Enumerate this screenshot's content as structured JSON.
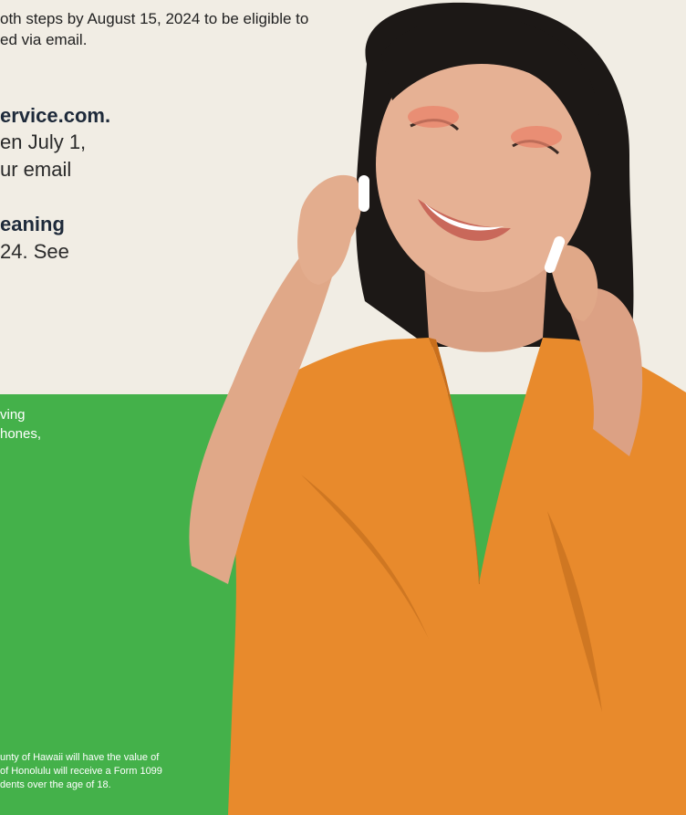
{
  "intro": {
    "line1": "oth steps by August 15, 2024 to be eligible to",
    "line2": "ed via email."
  },
  "step1": {
    "line1_bold": "ervice.com.",
    "line2": "en July 1,",
    "line3": "ur email"
  },
  "step2": {
    "line1_bold": "eaning",
    "line2": "24. See"
  },
  "green_panel": {
    "line1": "ving",
    "line2": "hones,"
  },
  "fine_print": {
    "line1": "unty of Hawaii will have the value of",
    "line2": "of Honolulu will receive a Form 1099",
    "line3": "dents over the age of 18."
  },
  "colors": {
    "background": "#f1ede4",
    "green": "#44b14a",
    "shirt": "#e88a2c"
  }
}
